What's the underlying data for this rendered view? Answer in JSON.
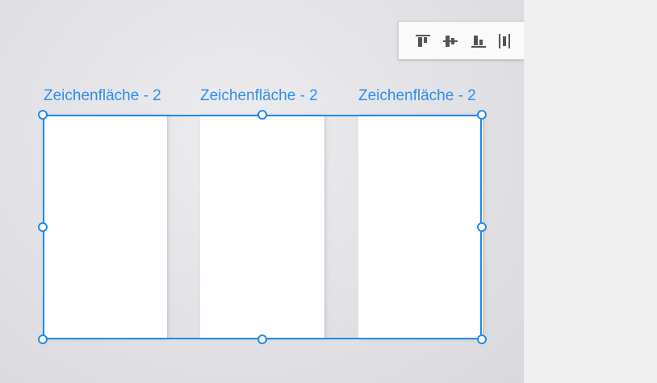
{
  "artboards": [
    {
      "label": "Zeichenfläche - 2"
    },
    {
      "label": "Zeichenfläche - 2"
    },
    {
      "label": "Zeichenfläche - 2"
    }
  ],
  "toolbar": {
    "tools": [
      {
        "icon": "align-top-icon"
      },
      {
        "icon": "align-vertical-center-icon"
      },
      {
        "icon": "align-bottom-icon"
      },
      {
        "icon": "distribute-horizontal-icon"
      },
      {
        "icon": "align-left-icon"
      },
      {
        "icon": "align-horizontal-center-icon"
      },
      {
        "icon": "align-right-icon"
      },
      {
        "icon": "distribute-vertical-icon"
      }
    ]
  },
  "colors": {
    "selection": "#1e8ae6",
    "label": "#2d8ceb",
    "icon": "#555555"
  }
}
